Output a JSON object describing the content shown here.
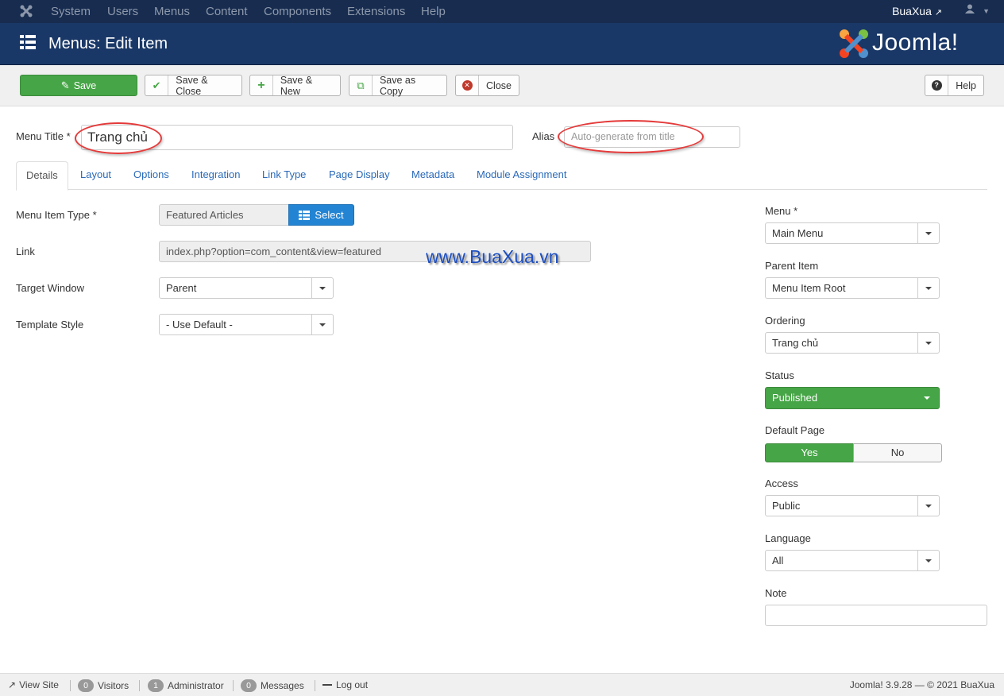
{
  "navbar": {
    "items": [
      "System",
      "Users",
      "Menus",
      "Content",
      "Components",
      "Extensions",
      "Help"
    ],
    "user": "BuaXua"
  },
  "header": {
    "title": "Menus: Edit Item",
    "brand": "Joomla!"
  },
  "toolbar": {
    "save": "Save",
    "save_close": "Save & Close",
    "save_new": "Save & New",
    "save_copy": "Save as Copy",
    "close": "Close",
    "help": "Help"
  },
  "form": {
    "menu_title_label": "Menu Title *",
    "menu_title_value": "Trang chủ",
    "alias_label": "Alias",
    "alias_placeholder": "Auto-generate from title"
  },
  "tabs": [
    "Details",
    "Layout",
    "Options",
    "Integration",
    "Link Type",
    "Page Display",
    "Metadata",
    "Module Assignment"
  ],
  "details": {
    "menu_item_type_label": "Menu Item Type *",
    "menu_item_type_value": "Featured Articles",
    "select_label": "Select",
    "link_label": "Link",
    "link_value": "index.php?option=com_content&view=featured",
    "target_window_label": "Target Window",
    "target_window_value": "Parent",
    "template_style_label": "Template Style",
    "template_style_value": "- Use Default -"
  },
  "sidebar": {
    "menu_label": "Menu *",
    "menu_value": "Main Menu",
    "parent_label": "Parent Item",
    "parent_value": "Menu Item Root",
    "ordering_label": "Ordering",
    "ordering_value": "Trang chủ",
    "status_label": "Status",
    "status_value": "Published",
    "default_page_label": "Default Page",
    "default_yes": "Yes",
    "default_no": "No",
    "access_label": "Access",
    "access_value": "Public",
    "language_label": "Language",
    "language_value": "All",
    "note_label": "Note"
  },
  "watermark": "www.BuaXua.vn",
  "statusbar": {
    "view_site": "View Site",
    "visitors_count": "0",
    "visitors": "Visitors",
    "admin_count": "1",
    "admin": "Administrator",
    "messages_count": "0",
    "messages": "Messages",
    "logout": "Log out",
    "version": "Joomla! 3.9.28 — © 2021 BuaXua"
  },
  "colors": {
    "navbar": "#172c4f",
    "header": "#1a3867",
    "success": "#46a546",
    "primary": "#2384d3",
    "annotation": "#e53a3a"
  }
}
